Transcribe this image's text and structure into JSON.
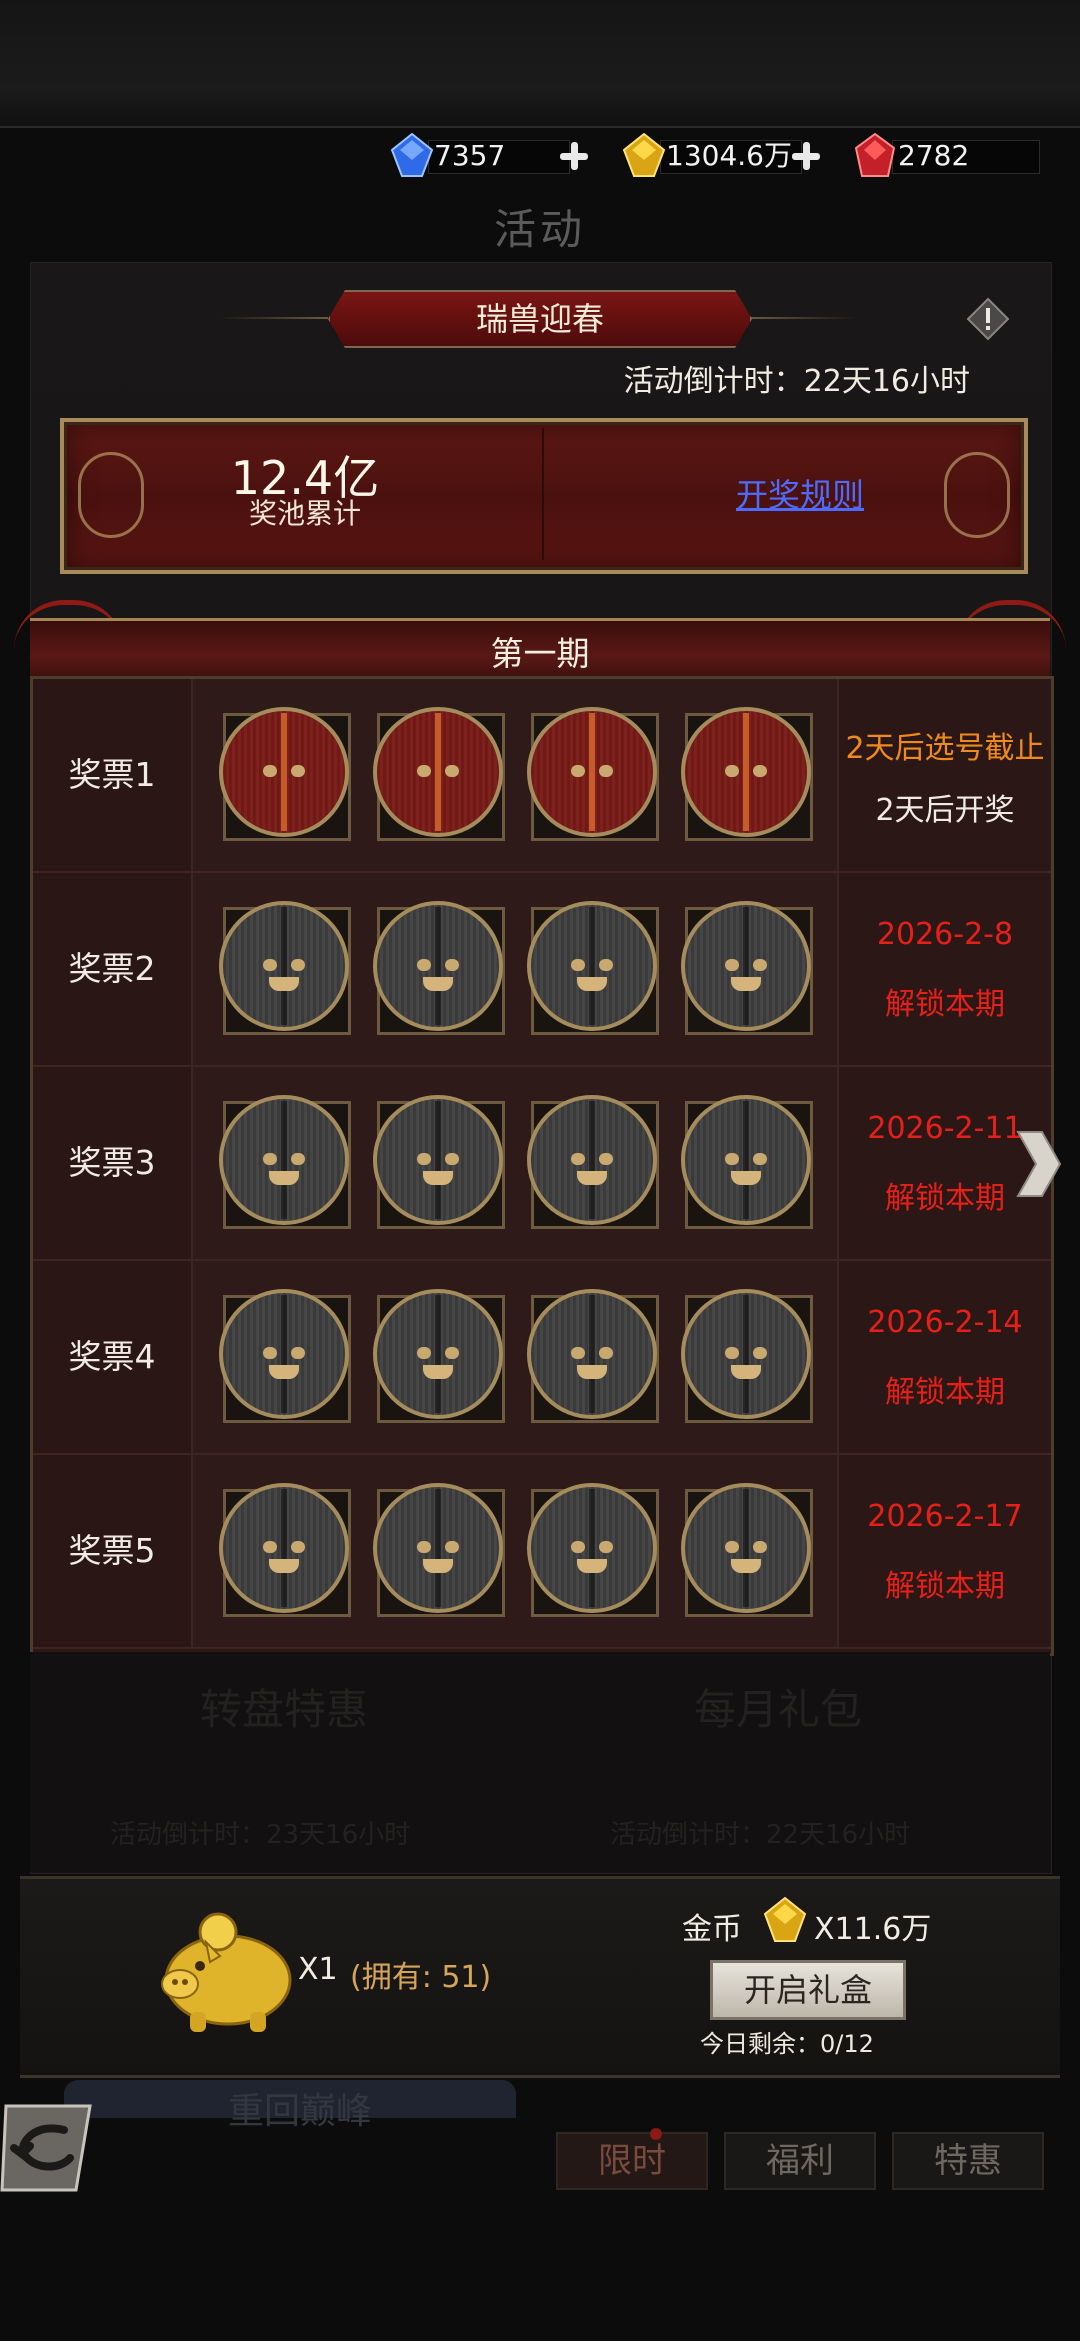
{
  "currency": {
    "diamond": "7357",
    "gold": "1304.6万",
    "ruby": "2782"
  },
  "page_title": "活动",
  "event": {
    "title": "瑞兽迎春",
    "countdown": "活动倒计时：22天16小时"
  },
  "pool": {
    "value": "12.4亿",
    "label": "奖池累计",
    "rules_link": "开奖规则"
  },
  "period_title": "第一期",
  "tickets": [
    {
      "label": "奖票1",
      "line1": "2天后选号截止",
      "line2": "2天后开奖"
    },
    {
      "label": "奖票2",
      "line1": "2026-2-8",
      "line2": "解锁本期"
    },
    {
      "label": "奖票3",
      "line1": "2026-2-11",
      "line2": "解锁本期"
    },
    {
      "label": "奖票4",
      "line1": "2026-2-14",
      "line2": "解锁本期"
    },
    {
      "label": "奖票5",
      "line1": "2026-2-17",
      "line2": "解锁本期"
    }
  ],
  "background_activities": {
    "left_title": "转盘特惠",
    "left_countdown": "活动倒计时：23天16小时",
    "right_title": "每月礼包",
    "right_countdown": "活动倒计时：22天16小时"
  },
  "gift": {
    "item_count": "X1",
    "owned": "(拥有: 51)",
    "coin_label": "金币",
    "coin_amount": "X11.6万",
    "open_button": "开启礼盒",
    "remaining": "今日剩余：0/12"
  },
  "bottom": {
    "faded_button": "重回巅峰",
    "tabs": [
      "限时",
      "福利",
      "特惠"
    ]
  },
  "colors": {
    "accent_red": "#e62019",
    "accent_orange": "#ef8a1c",
    "link_blue": "#4e6bff"
  }
}
